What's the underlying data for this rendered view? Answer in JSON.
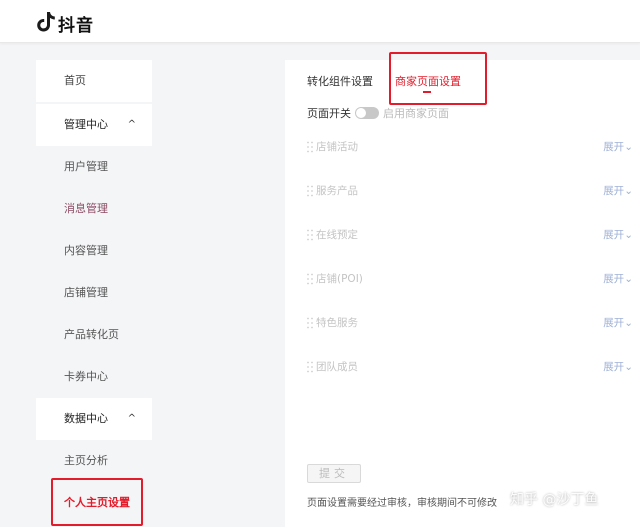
{
  "header": {
    "logo_text": "抖音",
    "logo_icon": "tiktok-note-icon"
  },
  "sidebar": {
    "items": [
      {
        "label": "首页"
      },
      {
        "label": "管理中心"
      },
      {
        "label": "用户管理"
      },
      {
        "label": "消息管理"
      },
      {
        "label": "内容管理"
      },
      {
        "label": "店铺管理"
      },
      {
        "label": "产品转化页"
      },
      {
        "label": "卡券中心"
      },
      {
        "label": "数据中心"
      },
      {
        "label": "主页分析"
      },
      {
        "label": "个人主页设置"
      }
    ],
    "caret": "^"
  },
  "tabs": [
    {
      "label": "转化组件设置"
    },
    {
      "label": "商家页面设置"
    }
  ],
  "page_switch": {
    "label": "页面开关",
    "toggle_text": "启用商家页面",
    "enabled": false
  },
  "sections": [
    {
      "label": "店铺活动",
      "action": "展开"
    },
    {
      "label": "服务产品",
      "action": "展开"
    },
    {
      "label": "在线预定",
      "action": "展开"
    },
    {
      "label": "店铺(POI)",
      "action": "展开"
    },
    {
      "label": "特色服务",
      "action": "展开"
    },
    {
      "label": "团队成员",
      "action": "展开"
    }
  ],
  "submit_label": "提交",
  "notice": "页面设置需要经过审核，审核期间不可修改",
  "watermark": "知乎 @沙丁鱼",
  "colors": {
    "accent": "#e31b2a",
    "expand_link": "#9fb2d6",
    "background": "#f4f5f7"
  }
}
